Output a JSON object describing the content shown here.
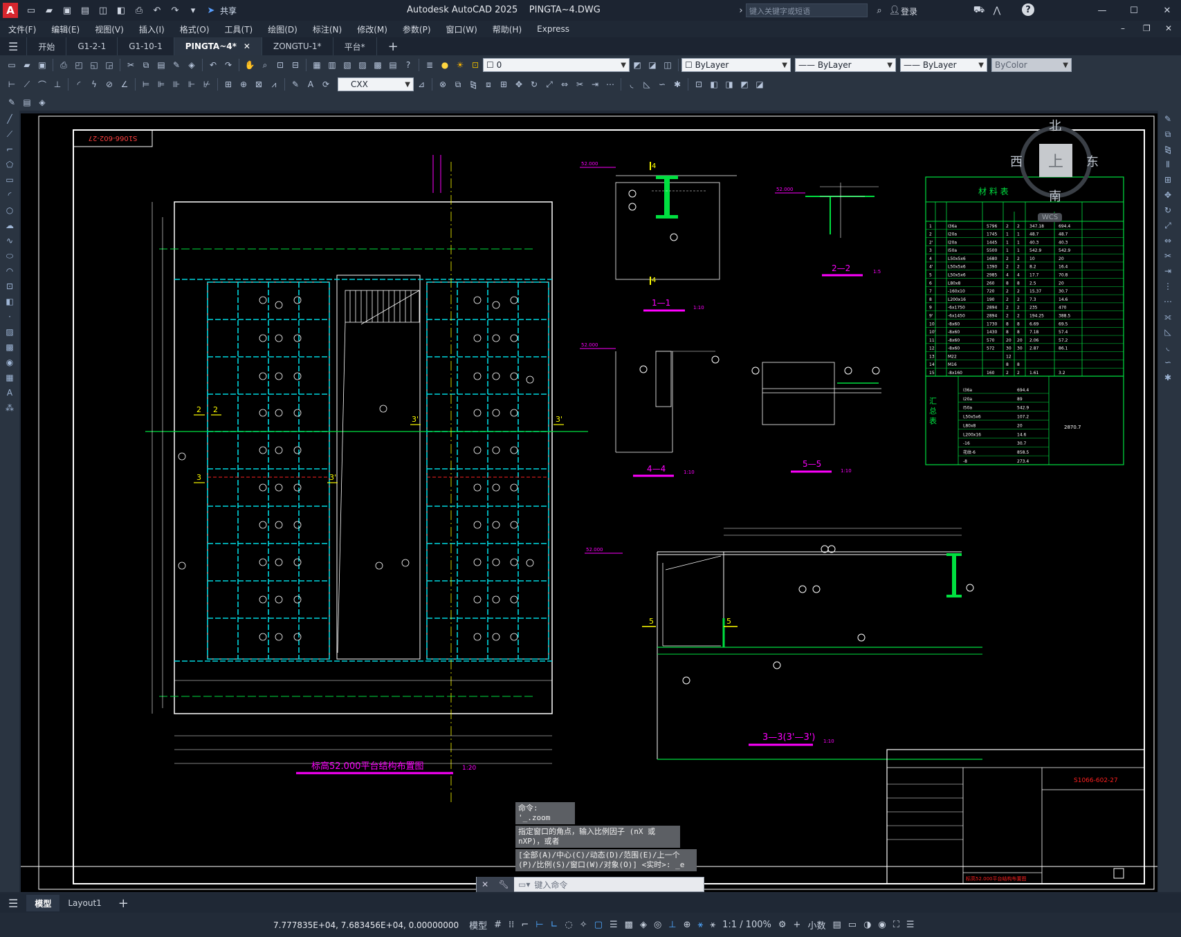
{
  "app": {
    "logo": "A",
    "title": "Autodesk AutoCAD 2025    PINGTA~4.DWG",
    "share_label": "共享",
    "search_placeholder": "键入关键字或短语",
    "login_label": "登录"
  },
  "menu": [
    "文件(F)",
    "编辑(E)",
    "视图(V)",
    "插入(I)",
    "格式(O)",
    "工具(T)",
    "绘图(D)",
    "标注(N)",
    "修改(M)",
    "参数(P)",
    "窗口(W)",
    "帮助(H)",
    "Express"
  ],
  "tabs": [
    {
      "label": "开始"
    },
    {
      "label": "G1-2-1"
    },
    {
      "label": "G1-10-1"
    },
    {
      "label": "PINGTA~4*",
      "active": true
    },
    {
      "label": "ZONGTU-1*"
    },
    {
      "label": "平台*"
    }
  ],
  "toolbar": {
    "layer_value": "0",
    "color_value": "ByLayer",
    "linetype_value": "ByLayer",
    "lineweight_value": "ByLayer",
    "plotstyle_value": "ByColor",
    "dimstyle_value": "CXX"
  },
  "viewcube": {
    "north": "北",
    "south": "南",
    "east": "东",
    "west": "西",
    "top": "上",
    "wcs": "WCS"
  },
  "drawing": {
    "plan_title": "标高52.000平台结构布置图",
    "plan_scale": "1:20",
    "section_1": "1—1",
    "section_1_scale": "1:10",
    "section_2": "2—2",
    "section_2_scale": "1:5",
    "section_4": "4—4",
    "section_4_scale": "1:10",
    "section_5": "5—5",
    "section_5_scale": "1:10",
    "section_3": "3—3(3'—3')",
    "section_3_scale": "1:10",
    "elev_label": "52.000",
    "table_title": "材 料 表",
    "summary_label": "汇 总 表",
    "summary_total": "2870.7",
    "drawing_no": "S1066-602-27",
    "titleblock_name": "标高52.000平台结构布置图",
    "table_rows": [
      [
        "1",
        "I36a",
        "5796",
        "2",
        "2",
        "347.18",
        "694.4"
      ],
      [
        "2",
        "I20a",
        "1745",
        "1",
        "1",
        "48.7",
        "48.7"
      ],
      [
        "2'",
        "I20a",
        "1445",
        "1",
        "1",
        "40.3",
        "40.3"
      ],
      [
        "3",
        "I50a",
        "5500",
        "1",
        "1",
        "542.9",
        "542.9"
      ],
      [
        "4",
        "L50x5x6",
        "1680",
        "2",
        "2",
        "10",
        "20"
      ],
      [
        "4'",
        "L50x5x6",
        "1390",
        "2",
        "2",
        "8.2",
        "16.4"
      ],
      [
        "5",
        "L50x5x6",
        "2985",
        "4",
        "4",
        "17.7",
        "70.8"
      ],
      [
        "6",
        "L80x8",
        "260",
        "8",
        "8",
        "2.5",
        "20"
      ],
      [
        "7",
        "-160x10",
        "720",
        "2",
        "2",
        "15.37",
        "30.7"
      ],
      [
        "8",
        "L200x16",
        "190",
        "2",
        "2",
        "7.3",
        "14.6"
      ],
      [
        "9",
        "-6x1750",
        "2894",
        "2",
        "2",
        "235",
        "470"
      ],
      [
        "9'",
        "-6x1450",
        "2894",
        "2",
        "2",
        "194.25",
        "388.5"
      ],
      [
        "10",
        "-8x60",
        "1730",
        "8",
        "8",
        "6.69",
        "69.5"
      ],
      [
        "10'",
        "-8x60",
        "1430",
        "8",
        "8",
        "7.18",
        "57.4"
      ],
      [
        "11",
        "-8x60",
        "570",
        "20",
        "20",
        "2.06",
        "57.2"
      ],
      [
        "12",
        "-8x60",
        "572",
        "30",
        "30",
        "2.87",
        "86.1"
      ],
      [
        "13",
        "M22",
        "",
        "12",
        "",
        "",
        ""
      ],
      [
        "14",
        "M16",
        "",
        "8",
        "8",
        "",
        ""
      ],
      [
        "15",
        "-8x160",
        "160",
        "2",
        "2",
        "1.61",
        "3.2"
      ]
    ],
    "summary_rows": [
      [
        "I36a",
        "694.4"
      ],
      [
        "I20a",
        "89"
      ],
      [
        "I50a",
        "542.9"
      ],
      [
        "L50x5x6",
        "107.2"
      ],
      [
        "L80x8",
        "20"
      ],
      [
        "L200x16",
        "14.6"
      ],
      [
        "-16",
        "30.7"
      ],
      [
        "花纹-6",
        "858.5"
      ],
      [
        "-8",
        "273.4"
      ]
    ]
  },
  "command": {
    "history": [
      "命令: '_.zoom",
      "指定窗口的角点，输入比例因子 (nX 或 nXP)，或者",
      "[全部(A)/中心(C)/动态(D)/范围(E)/上一个(P)/比例(S)/窗口(W)/对象(O)] <实时>: _e"
    ],
    "input_placeholder": "键入命令"
  },
  "layout_tabs": [
    {
      "label": "模型",
      "active": true
    },
    {
      "label": "Layout1"
    }
  ],
  "status": {
    "coords": "7.777835E+04, 7.683456E+04, 0.00000000",
    "model_label": "模型",
    "scale_label": "1:1 / 100%",
    "units_label": "小数"
  }
}
